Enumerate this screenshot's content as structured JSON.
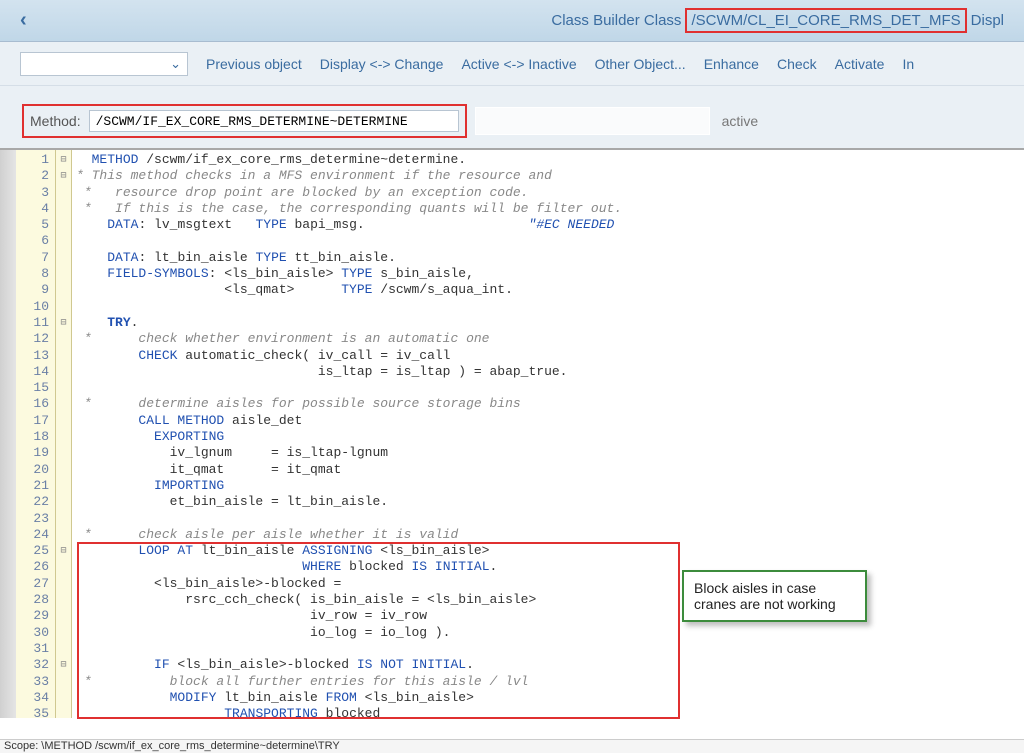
{
  "header": {
    "title_prefix": "Class Builder Class",
    "class_name": "/SCWM/CL_EI_CORE_RMS_DET_MFS",
    "title_suffix": "Displ"
  },
  "toolbar": {
    "items": [
      "Previous object",
      "Display <-> Change",
      "Active <-> Inactive",
      "Other Object...",
      "Enhance",
      "Check",
      "Activate",
      "In"
    ]
  },
  "method": {
    "label": "Method:",
    "value": "/SCWM/IF_EX_CORE_RMS_DETERMINE~DETERMINE",
    "status": "active"
  },
  "code": {
    "lines": [
      {
        "n": 1,
        "fold": "⊟",
        "html": "  <span class='kw'>METHOD</span> /scwm/if_ex_core_rms_determine~determine."
      },
      {
        "n": 2,
        "fold": "⊟",
        "html": "<span class='cm'>* This method checks in a MFS environment if the resource and</span>"
      },
      {
        "n": 3,
        "fold": "",
        "html": " <span class='cm'>*   resource drop point are blocked by an exception code.</span>"
      },
      {
        "n": 4,
        "fold": "",
        "html": " <span class='cm'>*   If this is the case, the corresponding quants will be filter out.</span>"
      },
      {
        "n": 5,
        "fold": "",
        "html": "    <span class='kw'>DATA</span>: lv_msgtext   <span class='kw'>TYPE</span> bapi_msg.                     <span class='cm2'>\"#EC NEEDED</span>"
      },
      {
        "n": 6,
        "fold": "",
        "html": ""
      },
      {
        "n": 7,
        "fold": "",
        "html": "    <span class='kw'>DATA</span>: lt_bin_aisle <span class='kw'>TYPE</span> tt_bin_aisle."
      },
      {
        "n": 8,
        "fold": "",
        "html": "    <span class='kw'>FIELD-SYMBOLS</span>: &lt;ls_bin_aisle&gt; <span class='kw'>TYPE</span> s_bin_aisle,"
      },
      {
        "n": 9,
        "fold": "",
        "html": "                   &lt;ls_qmat&gt;      <span class='kw'>TYPE</span> /scwm/s_aqua_int."
      },
      {
        "n": 10,
        "fold": "",
        "html": ""
      },
      {
        "n": 11,
        "fold": "⊟",
        "html": "    <span class='kwb'>TRY</span>."
      },
      {
        "n": 12,
        "fold": "",
        "html": " <span class='cm'>*      check whether environment is an automatic one</span>"
      },
      {
        "n": 13,
        "fold": "",
        "html": "        <span class='kw'>CHECK</span> automatic_check( iv_call = iv_call"
      },
      {
        "n": 14,
        "fold": "",
        "html": "                               is_ltap = is_ltap ) = abap_true."
      },
      {
        "n": 15,
        "fold": "",
        "html": ""
      },
      {
        "n": 16,
        "fold": "",
        "html": " <span class='cm'>*      determine aisles for possible source storage bins</span>"
      },
      {
        "n": 17,
        "fold": "",
        "html": "        <span class='kw'>CALL METHOD</span> aisle_det"
      },
      {
        "n": 18,
        "fold": "",
        "html": "          <span class='kw'>EXPORTING</span>"
      },
      {
        "n": 19,
        "fold": "",
        "html": "            iv_lgnum     = is_ltap-lgnum"
      },
      {
        "n": 20,
        "fold": "",
        "html": "            it_qmat      = it_qmat"
      },
      {
        "n": 21,
        "fold": "",
        "html": "          <span class='kw'>IMPORTING</span>"
      },
      {
        "n": 22,
        "fold": "",
        "html": "            et_bin_aisle = lt_bin_aisle."
      },
      {
        "n": 23,
        "fold": "",
        "html": ""
      },
      {
        "n": 24,
        "fold": "",
        "html": " <span class='cm'>*      check aisle per aisle whether it is valid</span>"
      },
      {
        "n": 25,
        "fold": "⊟",
        "html": "        <span class='kw'>LOOP AT</span> lt_bin_aisle <span class='kw'>ASSIGNING</span> &lt;ls_bin_aisle&gt;"
      },
      {
        "n": 26,
        "fold": "",
        "html": "                             <span class='kw'>WHERE</span> blocked <span class='kw'>IS INITIAL</span>."
      },
      {
        "n": 27,
        "fold": "",
        "html": "          &lt;ls_bin_aisle&gt;-blocked ="
      },
      {
        "n": 28,
        "fold": "",
        "html": "              rsrc_cch_check( is_bin_aisle = &lt;ls_bin_aisle&gt;"
      },
      {
        "n": 29,
        "fold": "",
        "html": "                              iv_row = iv_row"
      },
      {
        "n": 30,
        "fold": "",
        "html": "                              io_log = io_log )."
      },
      {
        "n": 31,
        "fold": "",
        "html": ""
      },
      {
        "n": 32,
        "fold": "⊟",
        "html": "          <span class='kw'>IF</span> &lt;ls_bin_aisle&gt;-blocked <span class='kw'>IS NOT INITIAL</span>."
      },
      {
        "n": 33,
        "fold": "",
        "html": " <span class='cm'>*          block all further entries for this aisle / lvl</span>"
      },
      {
        "n": 34,
        "fold": "",
        "html": "            <span class='kw'>MODIFY</span> lt_bin_aisle <span class='kw'>FROM</span> &lt;ls_bin_aisle&gt;"
      },
      {
        "n": 35,
        "fold": "",
        "html": "                   <span class='kw'>TRANSPORTING</span> blocked"
      }
    ]
  },
  "callout": {
    "text": "Block aisles in case cranes are not working"
  },
  "statusbar": {
    "text": "Scope: \\METHOD /scwm/if_ex_core_rms_determine~determine\\TRY"
  }
}
